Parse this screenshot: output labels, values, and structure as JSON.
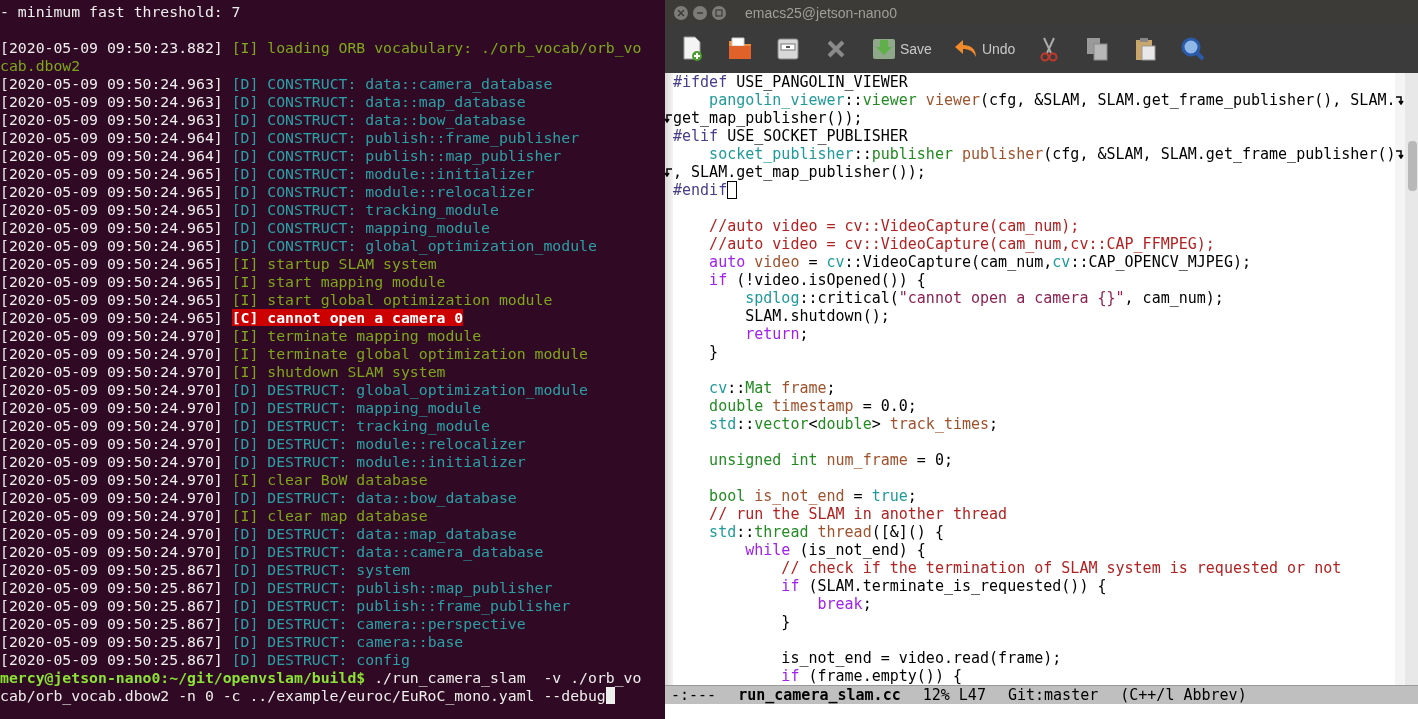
{
  "terminal": {
    "lines": [
      {
        "kind": "plain",
        "text": "- minimum fast threshold: 7"
      },
      {
        "kind": "blank"
      },
      {
        "kind": "info",
        "timestamp": "[2020-05-09 09:50:23.882]",
        "text": "[I] loading ORB vocabulary: ./orb_vocab/orb_vo",
        "wrap": "cab.dbow2"
      },
      {
        "kind": "debug",
        "timestamp": "[2020-05-09 09:50:24.963]",
        "text": "[D] CONSTRUCT: data::camera_database"
      },
      {
        "kind": "debug",
        "timestamp": "[2020-05-09 09:50:24.963]",
        "text": "[D] CONSTRUCT: data::map_database"
      },
      {
        "kind": "debug",
        "timestamp": "[2020-05-09 09:50:24.963]",
        "text": "[D] CONSTRUCT: data::bow_database"
      },
      {
        "kind": "debug",
        "timestamp": "[2020-05-09 09:50:24.964]",
        "text": "[D] CONSTRUCT: publish::frame_publisher"
      },
      {
        "kind": "debug",
        "timestamp": "[2020-05-09 09:50:24.964]",
        "text": "[D] CONSTRUCT: publish::map_publisher"
      },
      {
        "kind": "debug",
        "timestamp": "[2020-05-09 09:50:24.965]",
        "text": "[D] CONSTRUCT: module::initializer"
      },
      {
        "kind": "debug",
        "timestamp": "[2020-05-09 09:50:24.965]",
        "text": "[D] CONSTRUCT: module::relocalizer"
      },
      {
        "kind": "debug",
        "timestamp": "[2020-05-09 09:50:24.965]",
        "text": "[D] CONSTRUCT: tracking_module"
      },
      {
        "kind": "debug",
        "timestamp": "[2020-05-09 09:50:24.965]",
        "text": "[D] CONSTRUCT: mapping_module"
      },
      {
        "kind": "debug",
        "timestamp": "[2020-05-09 09:50:24.965]",
        "text": "[D] CONSTRUCT: global_optimization_module"
      },
      {
        "kind": "info",
        "timestamp": "[2020-05-09 09:50:24.965]",
        "text": "[I] startup SLAM system"
      },
      {
        "kind": "info",
        "timestamp": "[2020-05-09 09:50:24.965]",
        "text": "[I] start mapping module"
      },
      {
        "kind": "info",
        "timestamp": "[2020-05-09 09:50:24.965]",
        "text": "[I] start global optimization module"
      },
      {
        "kind": "critical",
        "timestamp": "[2020-05-09 09:50:24.965]",
        "text": "[C] cannot open a camera 0"
      },
      {
        "kind": "info",
        "timestamp": "[2020-05-09 09:50:24.970]",
        "text": "[I] terminate mapping module"
      },
      {
        "kind": "info",
        "timestamp": "[2020-05-09 09:50:24.970]",
        "text": "[I] terminate global optimization module"
      },
      {
        "kind": "info",
        "timestamp": "[2020-05-09 09:50:24.970]",
        "text": "[I] shutdown SLAM system"
      },
      {
        "kind": "debug",
        "timestamp": "[2020-05-09 09:50:24.970]",
        "text": "[D] DESTRUCT: global_optimization_module"
      },
      {
        "kind": "debug",
        "timestamp": "[2020-05-09 09:50:24.970]",
        "text": "[D] DESTRUCT: mapping_module"
      },
      {
        "kind": "debug",
        "timestamp": "[2020-05-09 09:50:24.970]",
        "text": "[D] DESTRUCT: tracking_module"
      },
      {
        "kind": "debug",
        "timestamp": "[2020-05-09 09:50:24.970]",
        "text": "[D] DESTRUCT: module::relocalizer"
      },
      {
        "kind": "debug",
        "timestamp": "[2020-05-09 09:50:24.970]",
        "text": "[D] DESTRUCT: module::initializer"
      },
      {
        "kind": "info",
        "timestamp": "[2020-05-09 09:50:24.970]",
        "text": "[I] clear BoW database"
      },
      {
        "kind": "debug",
        "timestamp": "[2020-05-09 09:50:24.970]",
        "text": "[D] DESTRUCT: data::bow_database"
      },
      {
        "kind": "info",
        "timestamp": "[2020-05-09 09:50:24.970]",
        "text": "[I] clear map database"
      },
      {
        "kind": "debug",
        "timestamp": "[2020-05-09 09:50:24.970]",
        "text": "[D] DESTRUCT: data::map_database"
      },
      {
        "kind": "debug",
        "timestamp": "[2020-05-09 09:50:24.970]",
        "text": "[D] DESTRUCT: data::camera_database"
      },
      {
        "kind": "debug",
        "timestamp": "[2020-05-09 09:50:25.867]",
        "text": "[D] DESTRUCT: system"
      },
      {
        "kind": "debug",
        "timestamp": "[2020-05-09 09:50:25.867]",
        "text": "[D] DESTRUCT: publish::map_publisher"
      },
      {
        "kind": "debug",
        "timestamp": "[2020-05-09 09:50:25.867]",
        "text": "[D] DESTRUCT: publish::frame_publisher"
      },
      {
        "kind": "debug",
        "timestamp": "[2020-05-09 09:50:25.867]",
        "text": "[D] DESTRUCT: camera::perspective"
      },
      {
        "kind": "debug",
        "timestamp": "[2020-05-09 09:50:25.867]",
        "text": "[D] DESTRUCT: camera::base"
      },
      {
        "kind": "debug",
        "timestamp": "[2020-05-09 09:50:25.867]",
        "text": "[D] DESTRUCT: config"
      }
    ],
    "prompt": {
      "location": "mercy@jetson-nano0:~/git/openvslam/build$",
      "command": "./run_camera_slam  -v ./orb_vo",
      "command_wrap": "cab/orb_vocab.dbow2 -n 0 -c ../example/euroc/EuRoC_mono.yaml --debug"
    }
  },
  "editor": {
    "window": {
      "title": "emacs25@jetson-nano0"
    },
    "toolbar": {
      "save_label": "Save",
      "undo_label": "Undo"
    },
    "code_lines": [
      {
        "kind": "code",
        "tokens": [
          {
            "kind": "pp",
            "text": "#ifdef"
          },
          {
            "kind": "p",
            "text": " USE_PANGOLIN_VIEWER"
          }
        ]
      },
      {
        "kind": "code",
        "wrapped": true,
        "tokens": [
          {
            "kind": "ns",
            "text": "    pangolin_viewer"
          },
          {
            "kind": "p",
            "text": "::"
          },
          {
            "kind": "type",
            "text": "viewer"
          },
          {
            "kind": "var",
            "text": " viewer"
          },
          {
            "kind": "p",
            "text": "(cfg, &SLAM, SLAM.get_frame_publisher(), SLAM."
          }
        ]
      },
      {
        "kind": "code",
        "continued": true,
        "tokens": [
          {
            "kind": "p",
            "text": "get_map_publisher());"
          }
        ]
      },
      {
        "kind": "code",
        "tokens": [
          {
            "kind": "pp",
            "text": "#elif"
          },
          {
            "kind": "p",
            "text": " USE_SOCKET_PUBLISHER"
          }
        ]
      },
      {
        "kind": "code",
        "wrapped": true,
        "tokens": [
          {
            "kind": "ns",
            "text": "    socket_publisher"
          },
          {
            "kind": "p",
            "text": "::"
          },
          {
            "kind": "type",
            "text": "publisher"
          },
          {
            "kind": "var",
            "text": " publisher"
          },
          {
            "kind": "p",
            "text": "(cfg, &SLAM, SLAM.get_frame_publisher()"
          }
        ]
      },
      {
        "kind": "code",
        "continued": true,
        "tokens": [
          {
            "kind": "p",
            "text": ", SLAM.get_map_publisher());"
          }
        ]
      },
      {
        "kind": "code",
        "cursor": true,
        "tokens": [
          {
            "kind": "pp",
            "text": "#endif"
          }
        ]
      },
      {
        "kind": "blank"
      },
      {
        "kind": "code",
        "tokens": [
          {
            "kind": "cm",
            "text": "    //auto video = cv::VideoCapture(cam_num);"
          }
        ]
      },
      {
        "kind": "code",
        "tokens": [
          {
            "kind": "cm",
            "text": "    //auto video = cv::VideoCapture(cam_num,cv::CAP_FFMPEG);"
          }
        ]
      },
      {
        "kind": "code",
        "tokens": [
          {
            "kind": "kw",
            "text": "    auto"
          },
          {
            "kind": "var",
            "text": " video"
          },
          {
            "kind": "p",
            "text": " = "
          },
          {
            "kind": "ns",
            "text": "cv"
          },
          {
            "kind": "p",
            "text": "::VideoCapture(cam_num,"
          },
          {
            "kind": "ns",
            "text": "cv"
          },
          {
            "kind": "p",
            "text": "::CAP_OPENCV_MJPEG);"
          }
        ]
      },
      {
        "kind": "code",
        "tokens": [
          {
            "kind": "kw",
            "text": "    if"
          },
          {
            "kind": "p",
            "text": " (!video.isOpened()) {"
          }
        ]
      },
      {
        "kind": "code",
        "tokens": [
          {
            "kind": "ns",
            "text": "        spdlog"
          },
          {
            "kind": "p",
            "text": "::critical("
          },
          {
            "kind": "str",
            "text": "\"cannot open a camera {}\""
          },
          {
            "kind": "p",
            "text": ", cam_num);"
          }
        ]
      },
      {
        "kind": "code",
        "tokens": [
          {
            "kind": "p",
            "text": "        SLAM.shutdown();"
          }
        ]
      },
      {
        "kind": "code",
        "tokens": [
          {
            "kind": "kw",
            "text": "        return"
          },
          {
            "kind": "p",
            "text": ";"
          }
        ]
      },
      {
        "kind": "code",
        "tokens": [
          {
            "kind": "p",
            "text": "    }"
          }
        ]
      },
      {
        "kind": "blank"
      },
      {
        "kind": "code",
        "tokens": [
          {
            "kind": "ns",
            "text": "    cv"
          },
          {
            "kind": "p",
            "text": "::"
          },
          {
            "kind": "type",
            "text": "Mat"
          },
          {
            "kind": "var",
            "text": " frame"
          },
          {
            "kind": "p",
            "text": ";"
          }
        ]
      },
      {
        "kind": "code",
        "tokens": [
          {
            "kind": "type",
            "text": "    double"
          },
          {
            "kind": "var",
            "text": " timestamp"
          },
          {
            "kind": "p",
            "text": " = 0.0;"
          }
        ]
      },
      {
        "kind": "code",
        "tokens": [
          {
            "kind": "ns",
            "text": "    std"
          },
          {
            "kind": "p",
            "text": "::"
          },
          {
            "kind": "type",
            "text": "vector"
          },
          {
            "kind": "p",
            "text": "<"
          },
          {
            "kind": "type",
            "text": "double"
          },
          {
            "kind": "p",
            "text": ">"
          },
          {
            "kind": "var",
            "text": " track_times"
          },
          {
            "kind": "p",
            "text": ";"
          }
        ]
      },
      {
        "kind": "blank"
      },
      {
        "kind": "code",
        "tokens": [
          {
            "kind": "type",
            "text": "    unsigned int"
          },
          {
            "kind": "var",
            "text": " num_frame"
          },
          {
            "kind": "p",
            "text": " = 0;"
          }
        ]
      },
      {
        "kind": "blank"
      },
      {
        "kind": "code",
        "tokens": [
          {
            "kind": "type",
            "text": "    bool"
          },
          {
            "kind": "var",
            "text": " is_not_end"
          },
          {
            "kind": "p",
            "text": " = "
          },
          {
            "kind": "const",
            "text": "true"
          },
          {
            "kind": "p",
            "text": ";"
          }
        ]
      },
      {
        "kind": "code",
        "tokens": [
          {
            "kind": "cm",
            "text": "    // run the SLAM in another thread"
          }
        ]
      },
      {
        "kind": "code",
        "tokens": [
          {
            "kind": "ns",
            "text": "    std"
          },
          {
            "kind": "p",
            "text": "::"
          },
          {
            "kind": "type",
            "text": "thread"
          },
          {
            "kind": "var",
            "text": " thread"
          },
          {
            "kind": "p",
            "text": "([&]() {"
          }
        ]
      },
      {
        "kind": "code",
        "tokens": [
          {
            "kind": "kw",
            "text": "        while"
          },
          {
            "kind": "p",
            "text": " (is_not_end) {"
          }
        ]
      },
      {
        "kind": "code",
        "tokens": [
          {
            "kind": "cm",
            "text": "            // check if the termination of SLAM system is requested or not"
          }
        ]
      },
      {
        "kind": "code",
        "tokens": [
          {
            "kind": "kw",
            "text": "            if"
          },
          {
            "kind": "p",
            "text": " (SLAM.terminate_is_requested()) {"
          }
        ]
      },
      {
        "kind": "code",
        "tokens": [
          {
            "kind": "kw",
            "text": "                break"
          },
          {
            "kind": "p",
            "text": ";"
          }
        ]
      },
      {
        "kind": "code",
        "tokens": [
          {
            "kind": "p",
            "text": "            }"
          }
        ]
      },
      {
        "kind": "blank"
      },
      {
        "kind": "code",
        "tokens": [
          {
            "kind": "p",
            "text": "            is_not_end = video.read(frame);"
          }
        ]
      },
      {
        "kind": "code",
        "tokens": [
          {
            "kind": "kw",
            "text": "            if"
          },
          {
            "kind": "p",
            "text": " (frame.empty()) {"
          }
        ]
      }
    ],
    "mode_line": {
      "status": "-:---",
      "buffer": "run_camera_slam.cc",
      "position": "12% L47",
      "vc": "Git:master",
      "mode": "(C++/l Abbrev)"
    }
  }
}
